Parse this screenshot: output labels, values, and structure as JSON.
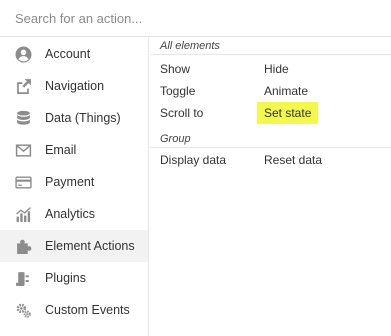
{
  "search": {
    "placeholder": "Search for an action..."
  },
  "sidebar": {
    "items": [
      {
        "label": "Account",
        "icon": "user-icon"
      },
      {
        "label": "Navigation",
        "icon": "external-link-icon"
      },
      {
        "label": "Data (Things)",
        "icon": "database-icon"
      },
      {
        "label": "Email",
        "icon": "envelope-icon"
      },
      {
        "label": "Payment",
        "icon": "credit-card-icon"
      },
      {
        "label": "Analytics",
        "icon": "chart-icon"
      },
      {
        "label": "Element Actions",
        "icon": "puzzle-icon",
        "active": true
      },
      {
        "label": "Plugins",
        "icon": "plug-icon"
      },
      {
        "label": "Custom Events",
        "icon": "gears-icon"
      }
    ]
  },
  "content": {
    "sections": [
      {
        "header": "All elements",
        "rows": [
          [
            "Show",
            "Hide"
          ],
          [
            "Toggle",
            "Animate"
          ],
          [
            "Scroll to",
            "Set state"
          ]
        ]
      },
      {
        "header": "Group",
        "rows": [
          [
            "Display data",
            "Reset data"
          ]
        ]
      }
    ],
    "highlighted_action": "Set state"
  },
  "colors": {
    "highlight": "#f3f84c",
    "active_item_bg": "#f2f2f2",
    "icon": "#8c8c8c"
  }
}
